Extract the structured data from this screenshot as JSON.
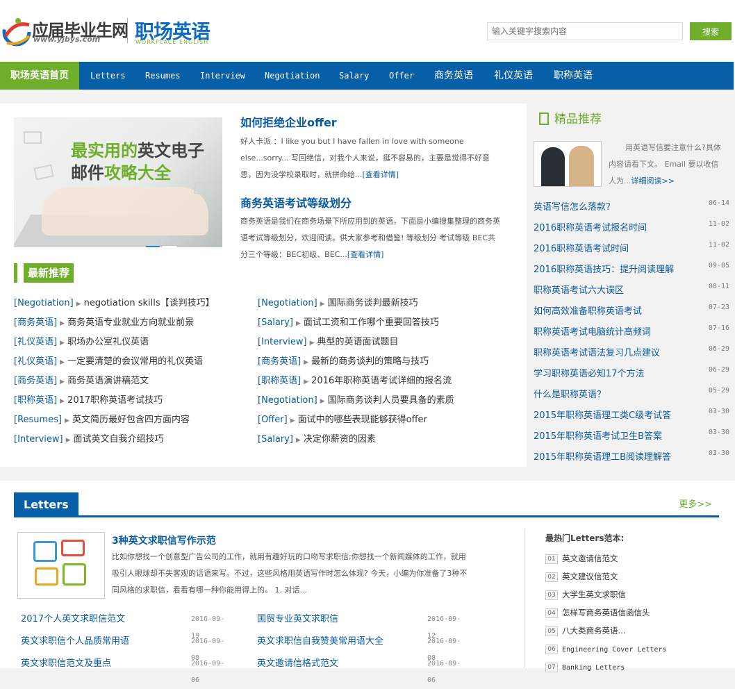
{
  "header": {
    "logo_cn": "应届毕业生网",
    "logo_url": "www.yjbys.com",
    "logo_sub": "职场英语",
    "logo_sub_en": "WORKPLACE ENGLISH",
    "search_placeholder": "输入关键字搜索内容",
    "search_button": "搜索"
  },
  "nav": {
    "home": "职场英语首页",
    "items": [
      "Letters",
      "Resumes",
      "Interview",
      "Negotiation",
      "Salary",
      "Offer",
      "商务英语",
      "礼仪英语",
      "职称英语"
    ]
  },
  "banner": {
    "line1_a": "最实用的",
    "line1_b": "英文电子",
    "line2_a": "邮件",
    "line2_b": "攻略大全"
  },
  "featured": [
    {
      "title": "如何拒绝企业offer",
      "body": "好人卡派 ：I like you but I have fallen in love with someone else...sorry... 写回绝信，对我个人来说，挺不容易的，主要是觉得不好意思，因为没学校录取时，就拼命给...",
      "more": "[查看详情]"
    },
    {
      "title": "商务英语考试等级划分",
      "body": "商务英语是我们在商务场景下所应用到的英语，下面是小编搜集整理的商务英语考试等级划分，欢迎阅读，供大家参考和借鉴! 等级划分 考试等级 BEC共分三个等级：BEC初级、BEC...",
      "more": "[查看详情]"
    }
  ],
  "latest": {
    "title": "最新推荐",
    "left": [
      {
        "cat": "[Negotiation]",
        "title": "negotiation skills【谈判技巧】"
      },
      {
        "cat": "[商务英语]",
        "title": "商务英语专业就业方向就业前景"
      },
      {
        "cat": "[礼仪英语]",
        "title": "职场办公室礼仪英语"
      },
      {
        "cat": "[礼仪英语]",
        "title": "一定要清楚的会议常用的礼仪英语"
      },
      {
        "cat": "[商务英语]",
        "title": "商务英语演讲稿范文"
      },
      {
        "cat": "[职称英语]",
        "title": "2017职称英语考试技巧"
      },
      {
        "cat": "[Resumes]",
        "title": "英文简历最好包含四方面内容"
      },
      {
        "cat": "[Interview]",
        "title": "面试英文自我介绍技巧"
      }
    ],
    "right": [
      {
        "cat": "[Negotiation]",
        "title": "国际商务谈判最新技巧"
      },
      {
        "cat": "[Salary]",
        "title": "面试工资和工作哪个重要回答技巧"
      },
      {
        "cat": "[Interview]",
        "title": "典型的英语面试题目"
      },
      {
        "cat": "[商务英语]",
        "title": "最新的商务谈判的策略与技巧"
      },
      {
        "cat": "[职称英语]",
        "title": "2016年职称英语考试详细的报名流"
      },
      {
        "cat": "[Negotiation]",
        "title": "国际商务谈判人员要具备的素质"
      },
      {
        "cat": "[Offer]",
        "title": "面试中的哪些表现能够获得offer"
      },
      {
        "cat": "[Salary]",
        "title": "决定你薪资的因素"
      }
    ]
  },
  "sidebar": {
    "title": "精品推荐",
    "desc": "用英语写信要注意什么?具体内容请看下文。 Email 要以收信人为...",
    "desc_more": "详细阅读>>",
    "items": [
      {
        "title": "英语写信怎么落款？",
        "date": "06-14"
      },
      {
        "title": "2016职称英语考试报名时间",
        "date": "11-02"
      },
      {
        "title": "2016职称英语考试时间",
        "date": "11-02"
      },
      {
        "title": "2016职称英语技巧：提升阅读理解",
        "date": "09-05"
      },
      {
        "title": "职称英语考试六大误区",
        "date": "08-11"
      },
      {
        "title": "如何高效准备职称英语考试",
        "date": "07-23"
      },
      {
        "title": "职称英语考试电脑统计高频词",
        "date": "07-16"
      },
      {
        "title": "职称英语考试语法复习几点建议",
        "date": "06-29"
      },
      {
        "title": "学习职称英语必知17个方法",
        "date": "06-29"
      },
      {
        "title": "什么是职称英语？",
        "date": "05-29"
      },
      {
        "title": "2015年职称英语理工类C级考试答",
        "date": "03-30"
      },
      {
        "title": "2015年职称英语考试卫生B答案",
        "date": "03-30"
      },
      {
        "title": "2015年职称英语理工B阅读理解答",
        "date": "03-30"
      }
    ]
  },
  "letters": {
    "title": "Letters",
    "more": "更多>>",
    "featured_title": "3种英文求职信写作示范",
    "featured_body": "比如你想找一个创意型广告公司的工作，就用有趣好玩的口吻写求职信;你想找一个新闻媒体的工作，就用吸引人眼球却不失客观的话语来写。不过，这些风格用英语写作时怎么体现? 今天，小编为你准备了3种不同风格的求职信，看看有哪一种你能用得上的。 1. 对话...",
    "col1": [
      {
        "title": "2017个人英文求职信范文",
        "date": "2016-09-19"
      },
      {
        "title": "英文求职信个人品质常用语",
        "date": "2016-09-08"
      },
      {
        "title": "英文求职信范文及重点",
        "date": "2016-09-06"
      }
    ],
    "col2": [
      {
        "title": "国贸专业英文求职信",
        "date": "2016-09-12"
      },
      {
        "title": "英文求职信自我赞美常用语大全",
        "date": "2016-09-08"
      },
      {
        "title": "英文邀请信格式范文",
        "date": "2016-09-06"
      }
    ],
    "hot_title": "最热门Letters范本:",
    "hot": [
      {
        "n": "01",
        "title": "英文邀请信范文"
      },
      {
        "n": "02",
        "title": "英文建议信范文"
      },
      {
        "n": "03",
        "title": "大学生英文求职信"
      },
      {
        "n": "04",
        "title": "怎样写商务英语信函信头"
      },
      {
        "n": "05",
        "title": "八大类商务英语..."
      },
      {
        "n": "06",
        "title": "Engineering Cover Letters"
      },
      {
        "n": "07",
        "title": "Banking Letters"
      }
    ]
  },
  "colors": {
    "brand_blue": "#075fa8",
    "brand_green": "#6fae2a",
    "link_blue": "#0a5a9e"
  }
}
